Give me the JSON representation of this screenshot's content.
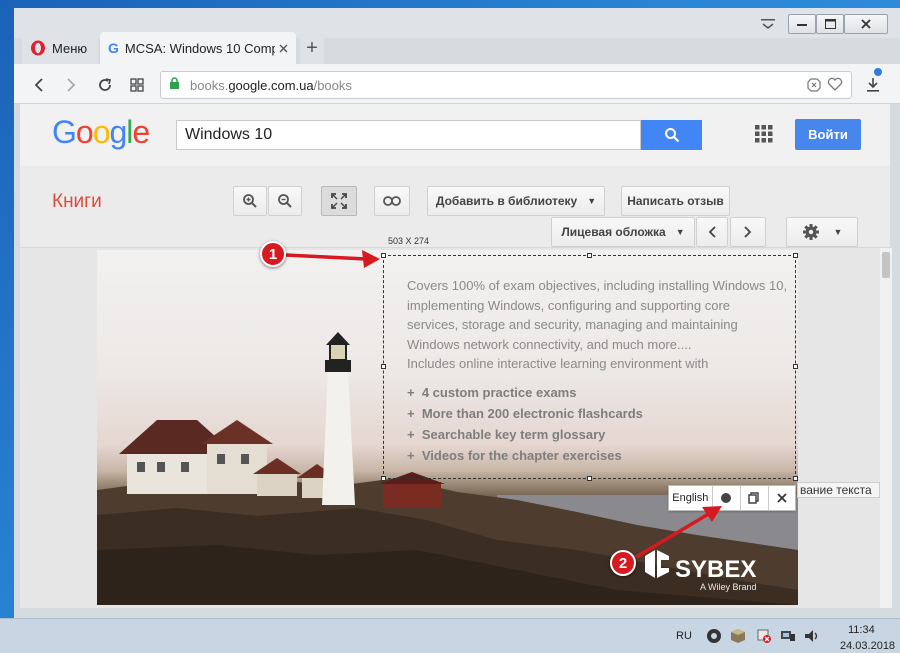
{
  "browser": {
    "menu_label": "Меню",
    "tab_title": "MCSA: Windows 10 Comp",
    "new_tab": "+",
    "url_host_prefix": "books.",
    "url_host": "google.com.ua",
    "url_path": "/books"
  },
  "google": {
    "logo": "Google",
    "search_value": "Windows 10",
    "signin_label": "Войти",
    "section_title": "Книги",
    "add_library_label": "Добавить в библиотеку",
    "write_review_label": "Написать отзыв",
    "page_select_label": "Лицевая обложка"
  },
  "book_cover": {
    "selection_size": "503 X 274",
    "description_lines": [
      "Covers 100% of exam objectives, including installing Windows 10,",
      "implementing Windows, configuring and supporting core",
      "services, storage and security, managing and maintaining",
      "Windows network connectivity, and much more....",
      "Includes online interactive learning environment with"
    ],
    "bullets": [
      "4 custom practice exams",
      "More than 200 electronic flashcards",
      "Searchable key term glossary",
      "Videos for the chapter exercises"
    ],
    "brand": "SYBEX",
    "brand_sub": "A Wiley Brand"
  },
  "capture_toolbar": {
    "language_label": "English",
    "overflow_text": "вание текста"
  },
  "annotations": {
    "marker_1": "1",
    "marker_2": "2",
    "color": "#d71920"
  },
  "taskbar": {
    "language": "RU",
    "time": "11:34",
    "date": "24.03.2018"
  },
  "colors": {
    "google_blue": "#4285f4",
    "signin_blue": "#4787ed",
    "books_red": "#dd4b39",
    "secure_green": "#2fa14a"
  }
}
